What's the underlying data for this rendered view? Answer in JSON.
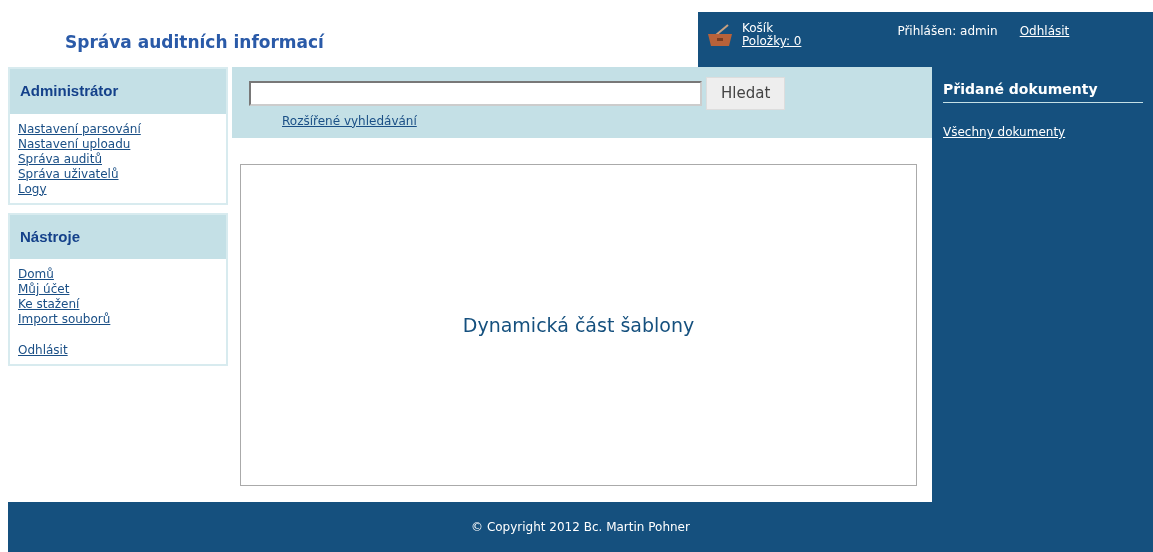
{
  "header": {
    "title": "Správa auditních informací",
    "cart": {
      "label": "Košík",
      "items": "Položky: 0"
    },
    "login": "Přihlášen: admin",
    "logout": "Odhlásit"
  },
  "sidebar": [
    {
      "title": "Administrátor",
      "link_groups": [
        [
          {
            "label": "Nastavení parsování"
          },
          {
            "label": "Nastavení uploadu"
          },
          {
            "label": "Správa auditů"
          },
          {
            "label": "Správa uživatelů"
          },
          {
            "label": "Logy"
          }
        ]
      ]
    },
    {
      "title": "Nástroje",
      "link_groups": [
        [
          {
            "label": "Domů"
          },
          {
            "label": "Můj účet"
          },
          {
            "label": "Ke stažení"
          },
          {
            "label": "Import souborů"
          }
        ],
        [
          {
            "label": "Odhlásit"
          }
        ]
      ]
    }
  ],
  "search": {
    "button": "Hledat",
    "advanced": "Rozšířené vyhledávání"
  },
  "content": {
    "text": "Dynamická část šablony"
  },
  "right_panel": {
    "title": "Přidané dokumenty",
    "links": [
      {
        "label": "Všechny dokumenty"
      }
    ]
  },
  "footer": "© Copyright 2012 Bc. Martin Pohner"
}
